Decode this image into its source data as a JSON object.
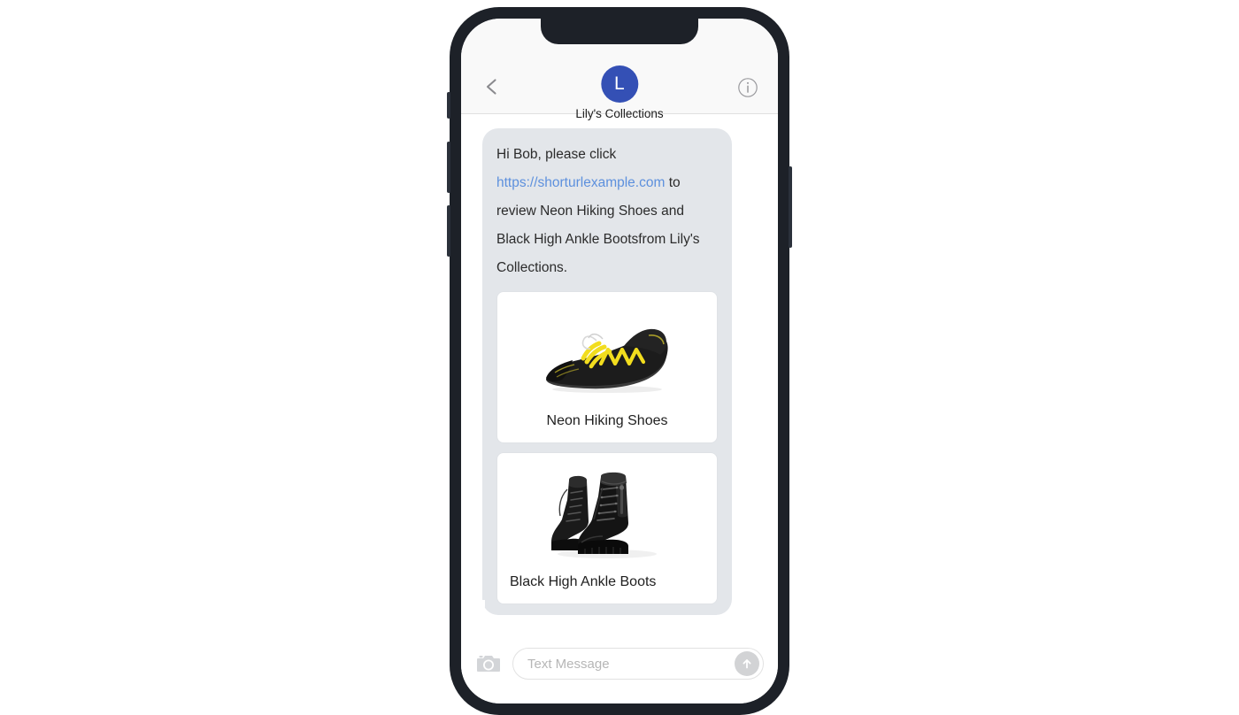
{
  "device": {
    "type": "smartphone",
    "frame_color": "#1d2128",
    "side_buttons": [
      "silent-switch",
      "volume-up",
      "volume-down",
      "power"
    ]
  },
  "header": {
    "back_icon": "chevron-left-icon",
    "info_icon": "info-circle-icon",
    "avatar_initial": "L",
    "avatar_color": "#3450b5",
    "contact_name": "Lily's Collections"
  },
  "conversation": {
    "messages": [
      {
        "sender": "them",
        "bubble_color": "#e3e6ea",
        "text_parts": [
          {
            "type": "text",
            "value": "Hi Bob, please click "
          },
          {
            "type": "link",
            "value": "https://shorturlexample.com",
            "color": "#5d90dd"
          },
          {
            "type": "text",
            "value": " to review Neon Hiking Shoes and Black High Ankle Bootsfrom Lily's Collections."
          }
        ],
        "text_plain": "Hi Bob, please click https://shorturlexample.com to review Neon Hiking Shoes and Black High Ankle Bootsfrom Lily's Collections.",
        "cards": [
          {
            "title": "Neon Hiking Shoes",
            "image_alt": "black-hiking-shoe-with-yellow-laces",
            "image_colors": {
              "body": "#1a1a1a",
              "accent": "#f2dd1e",
              "sole": "#2a2a2a"
            }
          },
          {
            "title": "Black High Ankle Boots",
            "image_alt": "pair-of-black-leather-high-ankle-boots",
            "image_colors": {
              "body": "#161616",
              "highlight": "#4a4a4a",
              "sole": "#101010"
            }
          }
        ]
      }
    ]
  },
  "composer": {
    "camera_icon": "camera-icon",
    "input_value": "",
    "input_placeholder": "Text Message",
    "send_icon": "arrow-up-circle-icon",
    "send_button_color": "#d2d3d5"
  }
}
